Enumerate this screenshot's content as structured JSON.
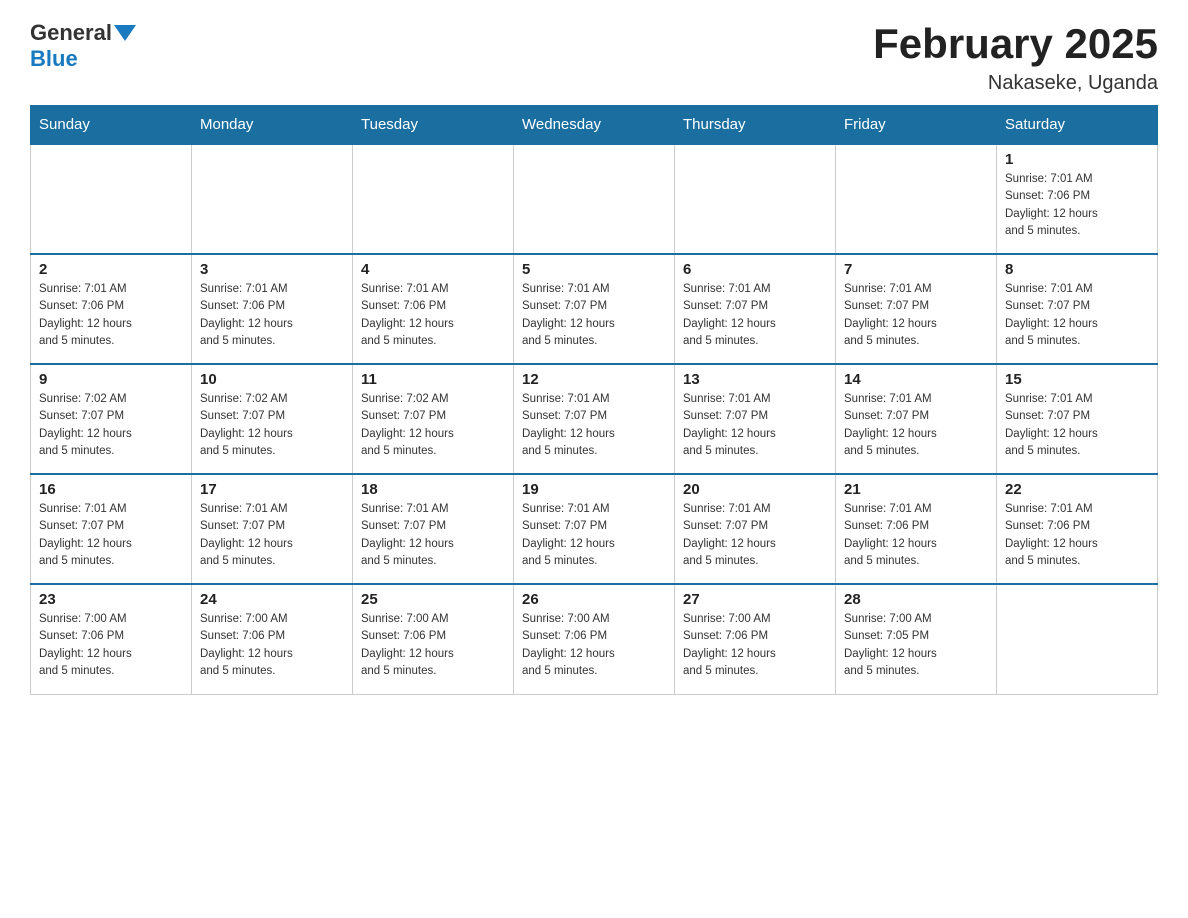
{
  "logo": {
    "general": "General",
    "blue": "Blue"
  },
  "title": {
    "month": "February 2025",
    "location": "Nakaseke, Uganda"
  },
  "weekdays": [
    "Sunday",
    "Monday",
    "Tuesday",
    "Wednesday",
    "Thursday",
    "Friday",
    "Saturday"
  ],
  "weeks": [
    [
      {
        "day": "",
        "info": ""
      },
      {
        "day": "",
        "info": ""
      },
      {
        "day": "",
        "info": ""
      },
      {
        "day": "",
        "info": ""
      },
      {
        "day": "",
        "info": ""
      },
      {
        "day": "",
        "info": ""
      },
      {
        "day": "1",
        "info": "Sunrise: 7:01 AM\nSunset: 7:06 PM\nDaylight: 12 hours\nand 5 minutes."
      }
    ],
    [
      {
        "day": "2",
        "info": "Sunrise: 7:01 AM\nSunset: 7:06 PM\nDaylight: 12 hours\nand 5 minutes."
      },
      {
        "day": "3",
        "info": "Sunrise: 7:01 AM\nSunset: 7:06 PM\nDaylight: 12 hours\nand 5 minutes."
      },
      {
        "day": "4",
        "info": "Sunrise: 7:01 AM\nSunset: 7:06 PM\nDaylight: 12 hours\nand 5 minutes."
      },
      {
        "day": "5",
        "info": "Sunrise: 7:01 AM\nSunset: 7:07 PM\nDaylight: 12 hours\nand 5 minutes."
      },
      {
        "day": "6",
        "info": "Sunrise: 7:01 AM\nSunset: 7:07 PM\nDaylight: 12 hours\nand 5 minutes."
      },
      {
        "day": "7",
        "info": "Sunrise: 7:01 AM\nSunset: 7:07 PM\nDaylight: 12 hours\nand 5 minutes."
      },
      {
        "day": "8",
        "info": "Sunrise: 7:01 AM\nSunset: 7:07 PM\nDaylight: 12 hours\nand 5 minutes."
      }
    ],
    [
      {
        "day": "9",
        "info": "Sunrise: 7:02 AM\nSunset: 7:07 PM\nDaylight: 12 hours\nand 5 minutes."
      },
      {
        "day": "10",
        "info": "Sunrise: 7:02 AM\nSunset: 7:07 PM\nDaylight: 12 hours\nand 5 minutes."
      },
      {
        "day": "11",
        "info": "Sunrise: 7:02 AM\nSunset: 7:07 PM\nDaylight: 12 hours\nand 5 minutes."
      },
      {
        "day": "12",
        "info": "Sunrise: 7:01 AM\nSunset: 7:07 PM\nDaylight: 12 hours\nand 5 minutes."
      },
      {
        "day": "13",
        "info": "Sunrise: 7:01 AM\nSunset: 7:07 PM\nDaylight: 12 hours\nand 5 minutes."
      },
      {
        "day": "14",
        "info": "Sunrise: 7:01 AM\nSunset: 7:07 PM\nDaylight: 12 hours\nand 5 minutes."
      },
      {
        "day": "15",
        "info": "Sunrise: 7:01 AM\nSunset: 7:07 PM\nDaylight: 12 hours\nand 5 minutes."
      }
    ],
    [
      {
        "day": "16",
        "info": "Sunrise: 7:01 AM\nSunset: 7:07 PM\nDaylight: 12 hours\nand 5 minutes."
      },
      {
        "day": "17",
        "info": "Sunrise: 7:01 AM\nSunset: 7:07 PM\nDaylight: 12 hours\nand 5 minutes."
      },
      {
        "day": "18",
        "info": "Sunrise: 7:01 AM\nSunset: 7:07 PM\nDaylight: 12 hours\nand 5 minutes."
      },
      {
        "day": "19",
        "info": "Sunrise: 7:01 AM\nSunset: 7:07 PM\nDaylight: 12 hours\nand 5 minutes."
      },
      {
        "day": "20",
        "info": "Sunrise: 7:01 AM\nSunset: 7:07 PM\nDaylight: 12 hours\nand 5 minutes."
      },
      {
        "day": "21",
        "info": "Sunrise: 7:01 AM\nSunset: 7:06 PM\nDaylight: 12 hours\nand 5 minutes."
      },
      {
        "day": "22",
        "info": "Sunrise: 7:01 AM\nSunset: 7:06 PM\nDaylight: 12 hours\nand 5 minutes."
      }
    ],
    [
      {
        "day": "23",
        "info": "Sunrise: 7:00 AM\nSunset: 7:06 PM\nDaylight: 12 hours\nand 5 minutes."
      },
      {
        "day": "24",
        "info": "Sunrise: 7:00 AM\nSunset: 7:06 PM\nDaylight: 12 hours\nand 5 minutes."
      },
      {
        "day": "25",
        "info": "Sunrise: 7:00 AM\nSunset: 7:06 PM\nDaylight: 12 hours\nand 5 minutes."
      },
      {
        "day": "26",
        "info": "Sunrise: 7:00 AM\nSunset: 7:06 PM\nDaylight: 12 hours\nand 5 minutes."
      },
      {
        "day": "27",
        "info": "Sunrise: 7:00 AM\nSunset: 7:06 PM\nDaylight: 12 hours\nand 5 minutes."
      },
      {
        "day": "28",
        "info": "Sunrise: 7:00 AM\nSunset: 7:05 PM\nDaylight: 12 hours\nand 5 minutes."
      },
      {
        "day": "",
        "info": ""
      }
    ]
  ]
}
